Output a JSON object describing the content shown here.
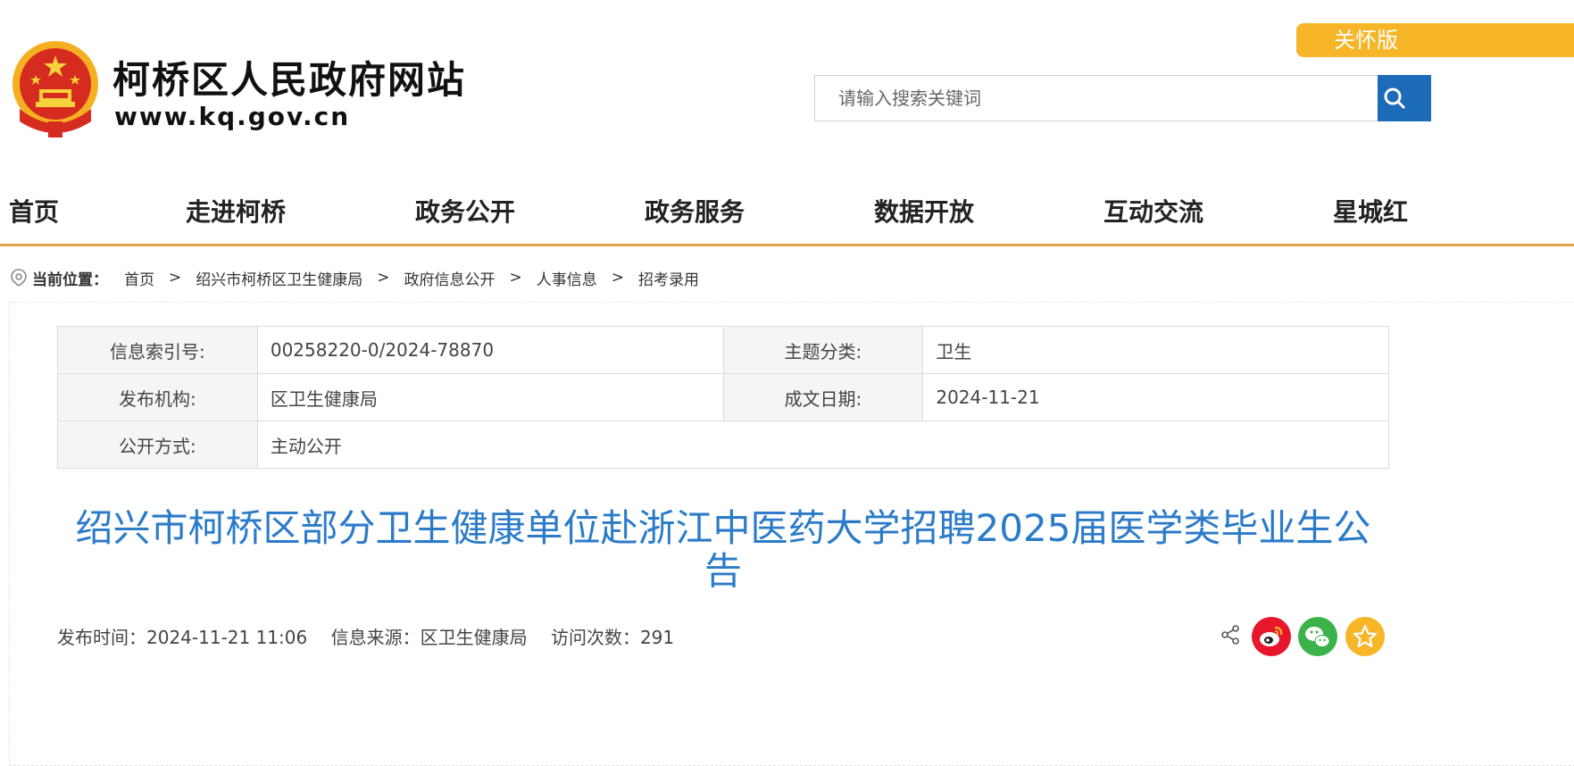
{
  "header": {
    "site_title": "柯桥区人民政府网站",
    "site_url": "www.kq.gov.cn",
    "care_label": "关怀版",
    "search_placeholder": "请输入搜索关键词"
  },
  "nav": [
    "首页",
    "走进柯桥",
    "政务公开",
    "政务服务",
    "数据开放",
    "互动交流",
    "星城红"
  ],
  "breadcrumb": {
    "label": "当前位置：",
    "items": [
      "首页",
      "绍兴市柯桥区卫生健康局",
      "政府信息公开",
      "人事信息",
      "招考录用"
    ],
    "separator": ">"
  },
  "info": {
    "index_key": "信息索引号:",
    "index_val": "00258220-0/2024-78870",
    "topic_key": "主题分类:",
    "topic_val": "卫生",
    "org_key": "发布机构:",
    "org_val": "区卫生健康局",
    "date_key": "成文日期:",
    "date_val": "2024-11-21",
    "open_key": "公开方式:",
    "open_val": "主动公开"
  },
  "article": {
    "title": "绍兴市柯桥区部分卫生健康单位赴浙江中医药大学招聘2025届医学类毕业生公告",
    "publish_time": "发布时间：2024-11-21 11:06",
    "source": "信息来源：区卫生健康局",
    "visits": "访问次数：291"
  },
  "colors": {
    "accent": "#2b7bc9",
    "nav_border": "#e0a54a",
    "care_bg": "#f7b528",
    "search_btn": "#1c6bb8"
  },
  "icons": [
    "national-emblem-icon",
    "search-icon",
    "location-pin-icon",
    "share-icon",
    "weibo-icon",
    "wechat-icon",
    "favorite-icon"
  ]
}
